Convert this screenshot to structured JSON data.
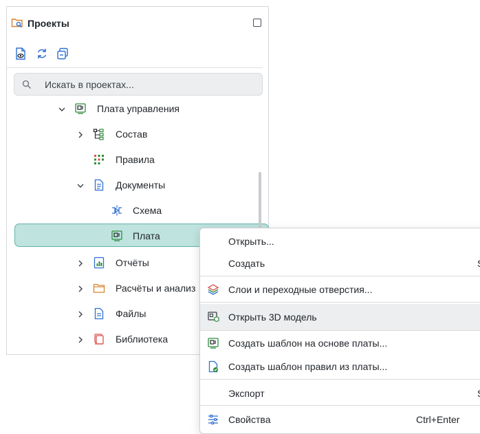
{
  "panel": {
    "title": "Проекты",
    "icons": {
      "title": "folder-search-icon",
      "maximize": "maximize-icon"
    },
    "toolbar": [
      {
        "icon": "file-eye-icon"
      },
      {
        "icon": "refresh-icon"
      },
      {
        "icon": "collapse-all-icon"
      }
    ],
    "search": {
      "placeholder": "Искать в проектах...",
      "value": ""
    }
  },
  "tree": [
    {
      "label": "Плата управления",
      "icon": "board-icon",
      "expanded": true,
      "has_children": true
    },
    {
      "label": "Состав",
      "icon": "structure-icon",
      "expanded": false,
      "has_children": true
    },
    {
      "label": "Правила",
      "icon": "rules-icon",
      "has_children": false
    },
    {
      "label": "Документы",
      "icon": "document-icon",
      "expanded": true,
      "has_children": true
    },
    {
      "label": "Схема",
      "icon": "schematic-icon",
      "has_children": false
    },
    {
      "label": "Плата",
      "icon": "board-icon",
      "has_children": false,
      "selected": true
    },
    {
      "label": "Отчёты",
      "icon": "report-icon",
      "expanded": false,
      "has_children": true
    },
    {
      "label": "Расчёты и анализ",
      "icon": "folder-icon",
      "expanded": false,
      "has_children": true
    },
    {
      "label": "Файлы",
      "icon": "file-icon",
      "expanded": false,
      "has_children": true
    },
    {
      "label": "Библиотека",
      "icon": "library-icon",
      "expanded": false,
      "has_children": true
    }
  ],
  "context_menu": {
    "items": [
      {
        "label": "Открыть...",
        "icon": "",
        "shortcut": ""
      },
      {
        "label": "Создать",
        "icon": "",
        "shortcut": "S"
      },
      {
        "label": "Слои и переходные отверстия...",
        "icon": "layers-icon",
        "shortcut": ""
      },
      {
        "label": "Открыть 3D модель",
        "icon": "model-3d-icon",
        "shortcut": "",
        "hover": true
      },
      {
        "label": "Создать шаблон на основе платы...",
        "icon": "board-template-icon",
        "shortcut": ""
      },
      {
        "label": "Создать шаблон правил из платы...",
        "icon": "rules-template-icon",
        "shortcut": ""
      },
      {
        "label": "Экспорт",
        "icon": "",
        "shortcut": "S"
      },
      {
        "label": "Свойства",
        "icon": "settings-sliders-icon",
        "shortcut": "Ctrl+Enter"
      }
    ]
  },
  "colors": {
    "selection_bg": "#bfe3df",
    "selection_border": "#63b3ab",
    "icon_blue": "#2f6fd1",
    "icon_green": "#2e8b3c",
    "icon_orange": "#d9822b",
    "icon_red": "#d9534f"
  }
}
